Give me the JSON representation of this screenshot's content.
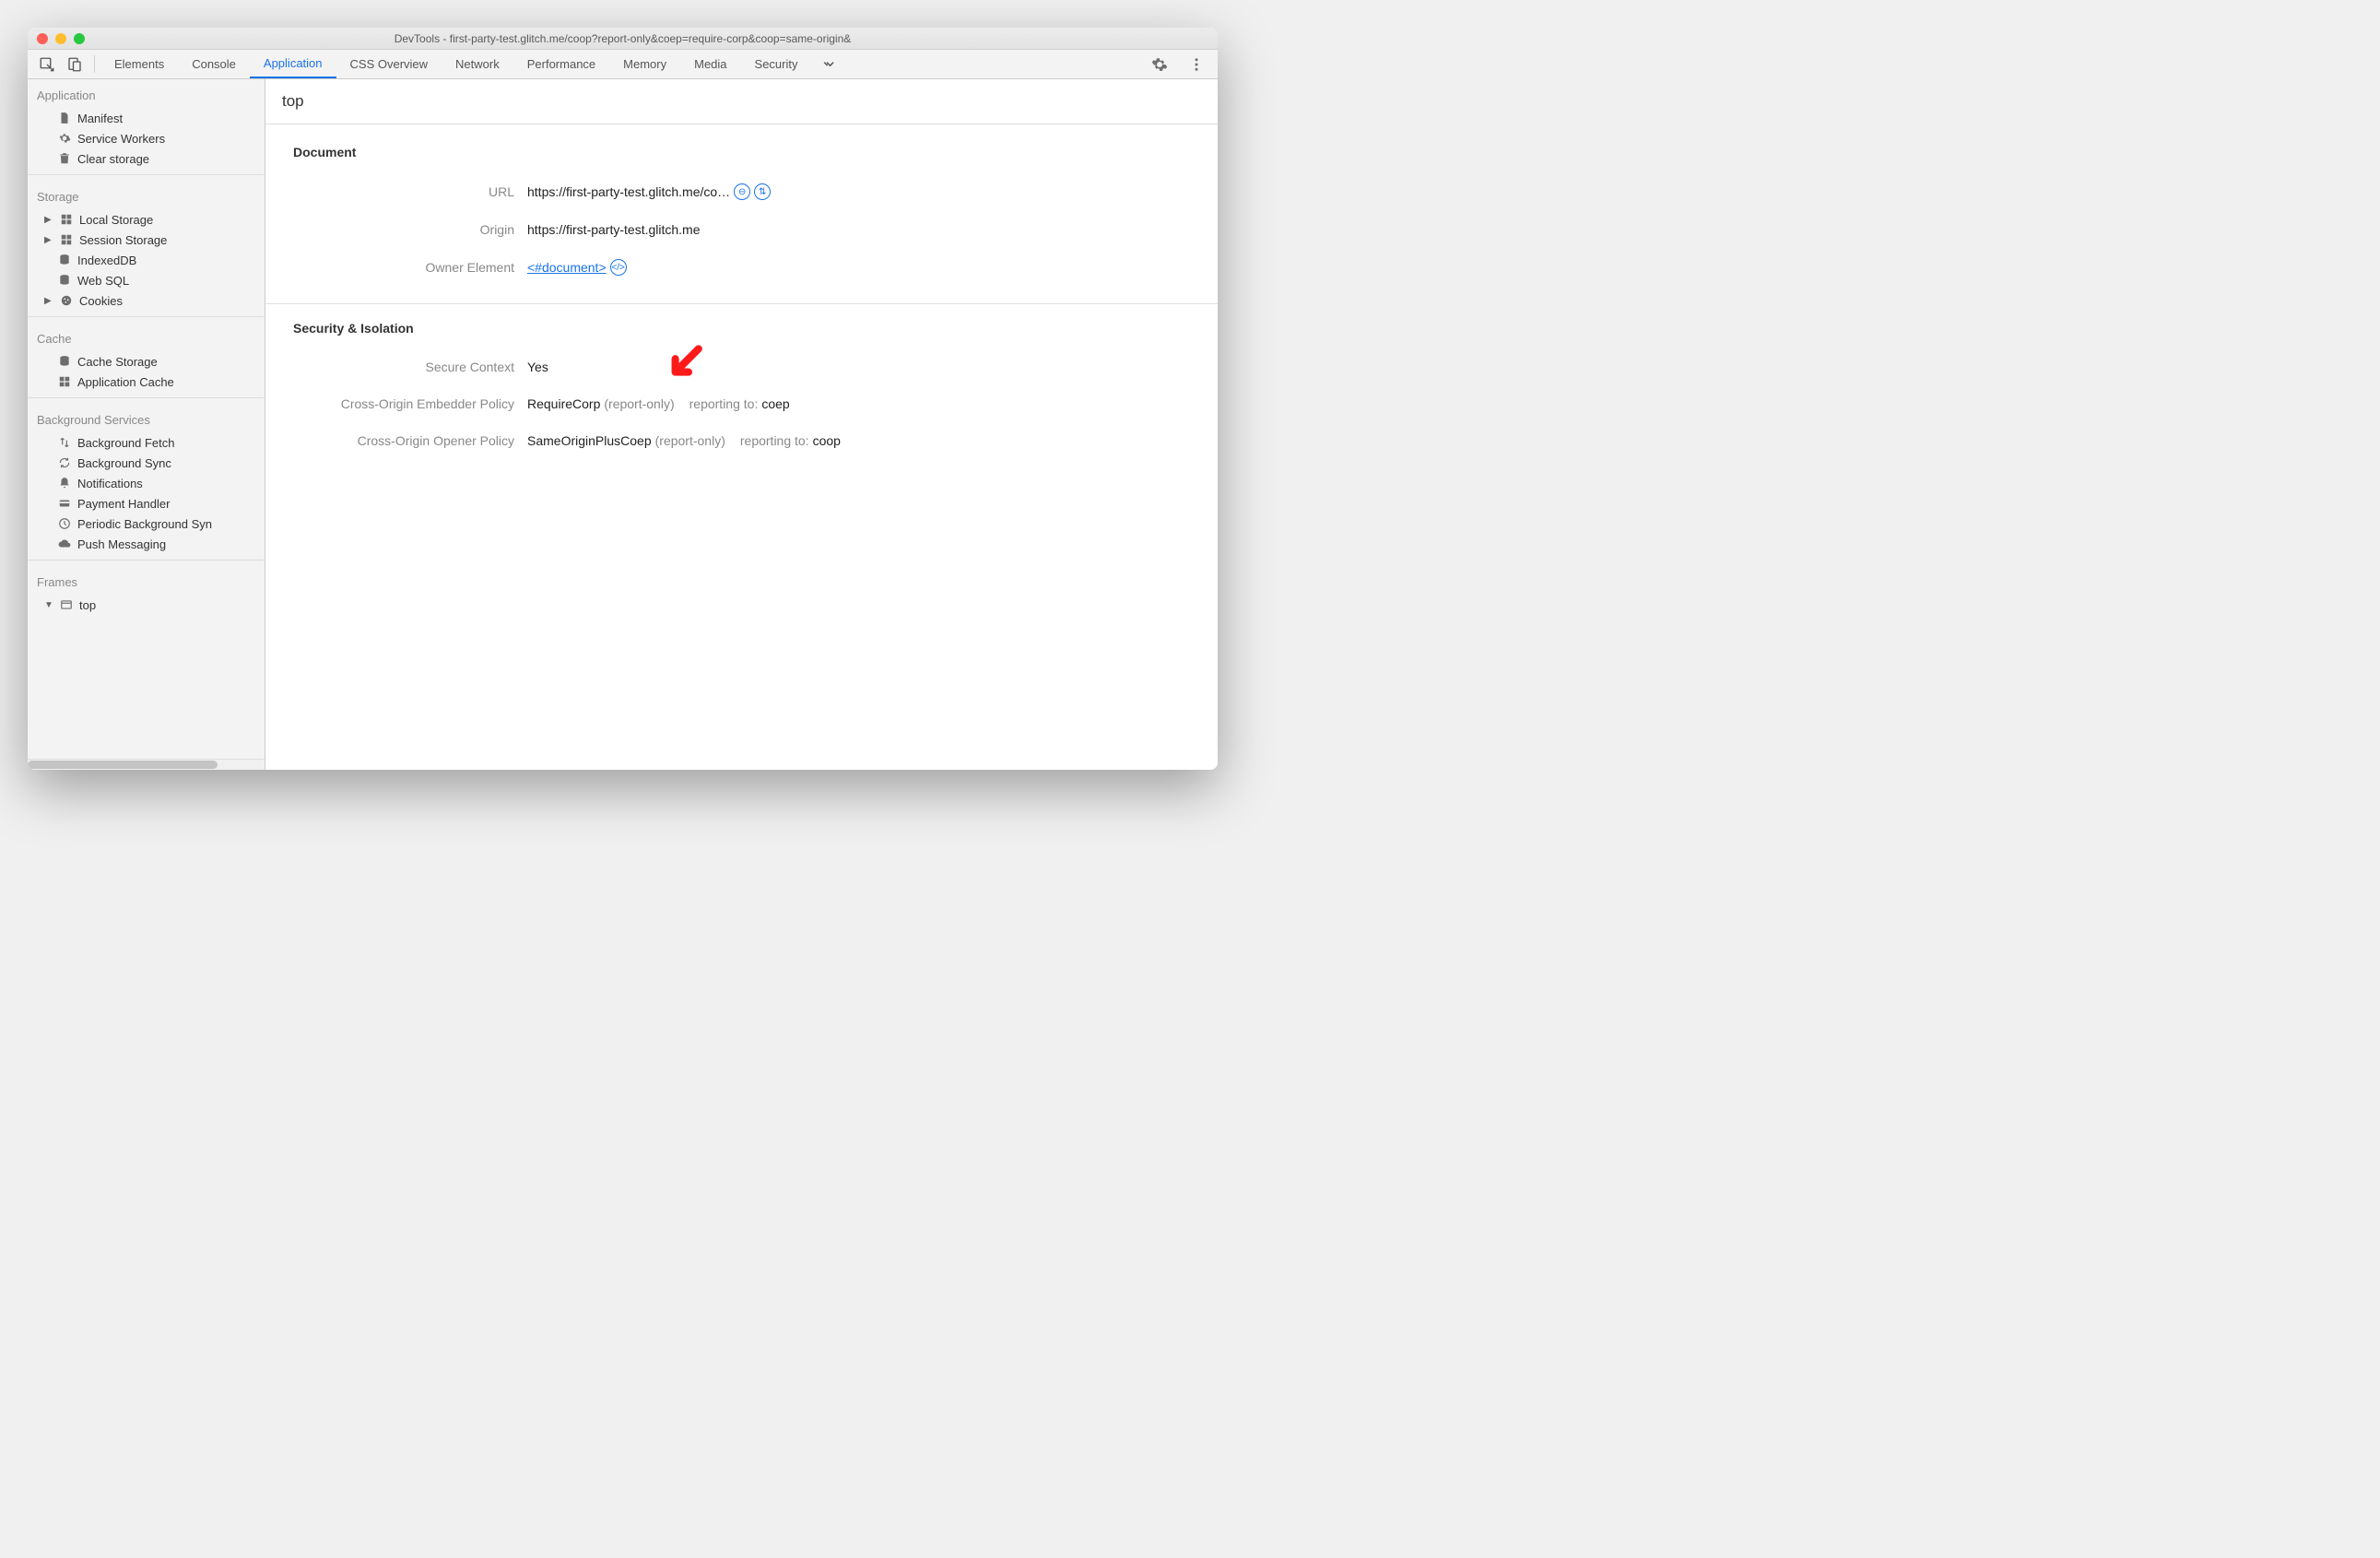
{
  "window": {
    "title": "DevTools - first-party-test.glitch.me/coop?report-only&coep=require-corp&coop=same-origin&"
  },
  "tabs": [
    {
      "label": "Elements",
      "active": false
    },
    {
      "label": "Console",
      "active": false
    },
    {
      "label": "Application",
      "active": true
    },
    {
      "label": "CSS Overview",
      "active": false
    },
    {
      "label": "Network",
      "active": false
    },
    {
      "label": "Performance",
      "active": false
    },
    {
      "label": "Memory",
      "active": false
    },
    {
      "label": "Media",
      "active": false
    },
    {
      "label": "Security",
      "active": false
    }
  ],
  "sidebar": {
    "sections": {
      "application": {
        "title": "Application",
        "items": [
          {
            "icon": "file-icon",
            "label": "Manifest"
          },
          {
            "icon": "gear-icon",
            "label": "Service Workers"
          },
          {
            "icon": "trash-icon",
            "label": "Clear storage"
          }
        ]
      },
      "storage": {
        "title": "Storage",
        "items": [
          {
            "icon": "grid-icon",
            "label": "Local Storage",
            "expandable": true
          },
          {
            "icon": "grid-icon",
            "label": "Session Storage",
            "expandable": true
          },
          {
            "icon": "db-icon",
            "label": "IndexedDB"
          },
          {
            "icon": "db-icon",
            "label": "Web SQL"
          },
          {
            "icon": "cookie-icon",
            "label": "Cookies",
            "expandable": true
          }
        ]
      },
      "cache": {
        "title": "Cache",
        "items": [
          {
            "icon": "db-icon",
            "label": "Cache Storage"
          },
          {
            "icon": "grid-icon",
            "label": "Application Cache"
          }
        ]
      },
      "background": {
        "title": "Background Services",
        "items": [
          {
            "icon": "updown-icon",
            "label": "Background Fetch"
          },
          {
            "icon": "sync-icon",
            "label": "Background Sync"
          },
          {
            "icon": "bell-icon",
            "label": "Notifications"
          },
          {
            "icon": "card-icon",
            "label": "Payment Handler"
          },
          {
            "icon": "clock-icon",
            "label": "Periodic Background Syn"
          },
          {
            "icon": "cloud-icon",
            "label": "Push Messaging"
          }
        ]
      },
      "frames": {
        "title": "Frames",
        "items": [
          {
            "icon": "window-icon",
            "label": "top",
            "expandable": true,
            "expanded": true
          }
        ]
      }
    }
  },
  "content": {
    "header": "top",
    "document": {
      "title": "Document",
      "url_label": "URL",
      "url_value": "https://first-party-test.glitch.me/co…",
      "origin_label": "Origin",
      "origin_value": "https://first-party-test.glitch.me",
      "owner_label": "Owner Element",
      "owner_value": "<#document>"
    },
    "security": {
      "title": "Security & Isolation",
      "secure_label": "Secure Context",
      "secure_value": "Yes",
      "coep_label": "Cross-Origin Embedder Policy",
      "coep_value": "RequireCorp",
      "coep_note": "(report-only)",
      "coep_reporting_label": "reporting to:",
      "coep_reporting_value": "coep",
      "coop_label": "Cross-Origin Opener Policy",
      "coop_value": "SameOriginPlusCoep",
      "coop_note": "(report-only)",
      "coop_reporting_label": "reporting to:",
      "coop_reporting_value": "coop"
    }
  }
}
